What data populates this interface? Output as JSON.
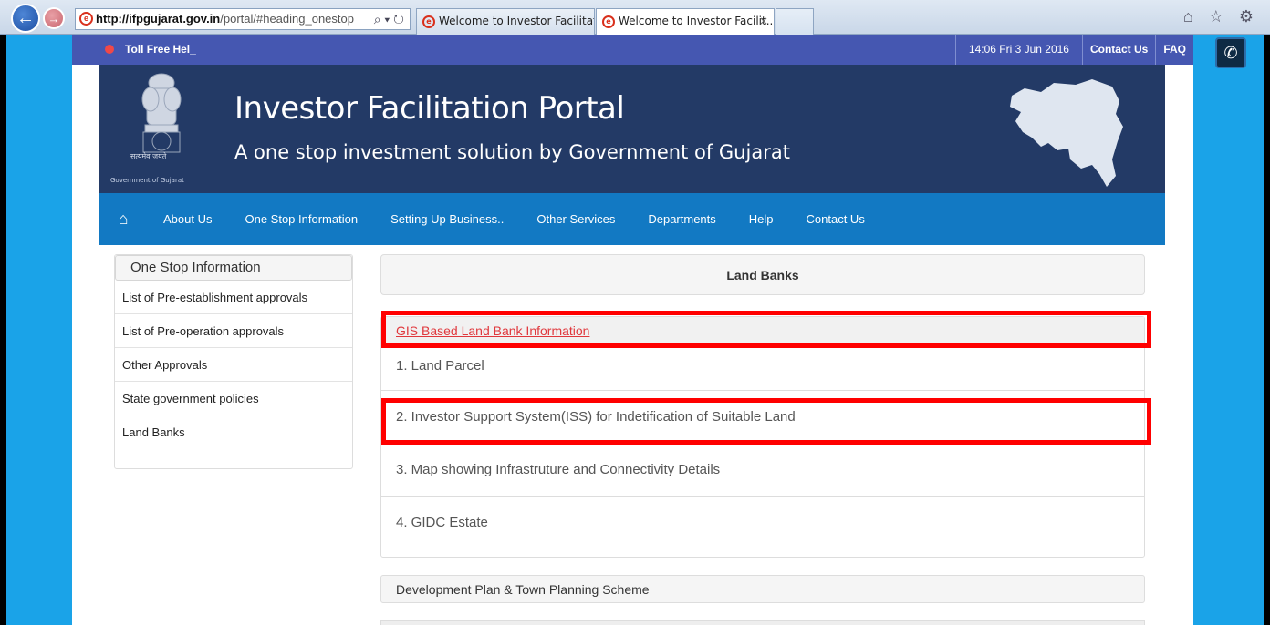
{
  "browser": {
    "url_domain": "http://ifpgujarat.gov.in",
    "url_path": "/portal/#heading_onestop",
    "url_tools": "⌕ ▾ ↻",
    "tabs": [
      {
        "title": "Welcome to Investor Facilitatio..."
      },
      {
        "title": "Welcome to Investor Facilit...",
        "close": "×"
      }
    ],
    "icons": [
      "home-icon",
      "star-icon",
      "gear-icon"
    ],
    "icon_glyphs": "⌂ ☆ ⚙"
  },
  "topbar": {
    "toll_free": "Toll Free Hel_",
    "datetime": "14:06  Fri  3 Jun 2016",
    "contact": "Contact Us",
    "faq": "FAQ"
  },
  "banner": {
    "title": "Investor Facilitation Portal",
    "subtitle": "A one stop investment solution by Government of Gujarat",
    "emblem_caption_1": "सत्यमेव जयते",
    "emblem_caption_2": "Government of Gujarat"
  },
  "menu": {
    "home_glyph": "⌂",
    "items": [
      "About Us",
      "One Stop Information",
      "Setting Up Business..",
      "Other Services",
      "Departments",
      "Help",
      "Contact Us"
    ]
  },
  "sidebar": {
    "heading": "One Stop Information",
    "items": [
      "List of Pre-establishment approvals",
      "List of Pre-operation approvals",
      "Other Approvals",
      "State government policies",
      "Land Banks"
    ]
  },
  "content": {
    "panel_title": "Land Banks",
    "gis_link": "GIS Based Land Bank Information",
    "items": [
      "1. Land Parcel",
      "2. Investor Support System(ISS) for Indetification of Suitable Land",
      "3. Map showing Infrastruture and Connectivity Details",
      "4. GIDC Estate"
    ],
    "dev_plan": "Development Plan & Town Planning Scheme"
  },
  "colors": {
    "accent": "#1aa3e8",
    "topbar": "#4557b1",
    "banner": "#233a66",
    "menu": "#1279c3",
    "highlight": "#ff0000"
  }
}
